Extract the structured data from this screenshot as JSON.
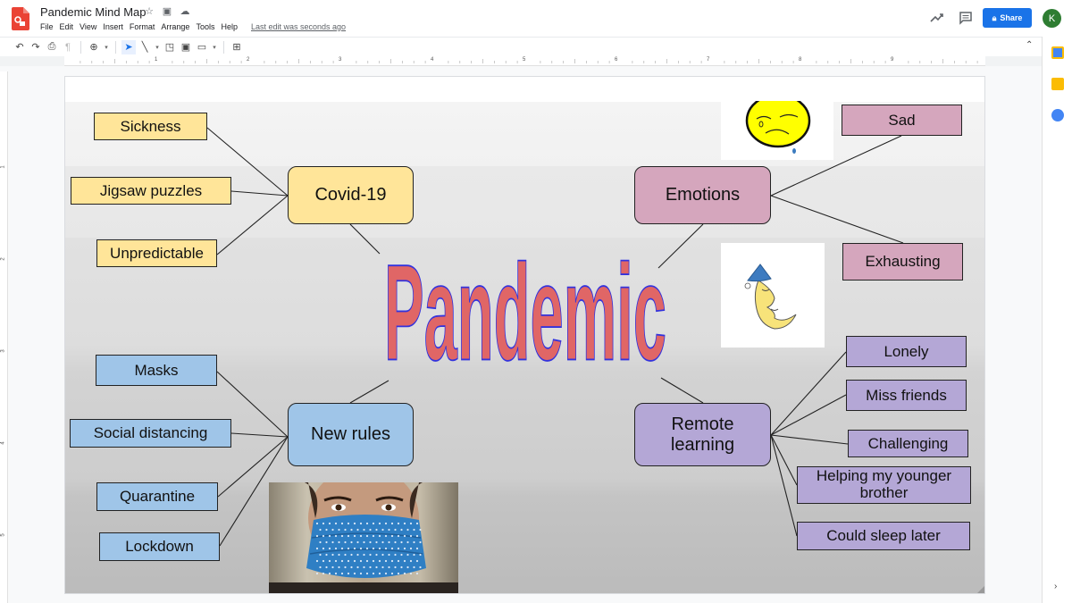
{
  "app": {
    "doc_title": "Pandemic Mind Map",
    "title_icons": [
      "star-icon",
      "move-to-folder-icon",
      "cloud-saved-icon"
    ],
    "menu": [
      "File",
      "Edit",
      "View",
      "Insert",
      "Format",
      "Arrange",
      "Tools",
      "Help"
    ],
    "last_edit": "Last edit was seconds ago",
    "share_label": "Share",
    "avatar_initial": "K",
    "accent_color": "#1a73e8"
  },
  "toolbar": {
    "buttons": [
      "undo",
      "redo",
      "print",
      "paint-format",
      "zoom",
      "select",
      "line",
      "shape",
      "text-box",
      "image",
      "comment"
    ]
  },
  "rulers": {
    "horizontal": [
      "1",
      "2",
      "3",
      "4",
      "5",
      "6",
      "7",
      "8",
      "9"
    ],
    "vertical": [
      "1",
      "2",
      "3",
      "4",
      "5"
    ]
  },
  "side_panel": {
    "icons": [
      "calendar-icon",
      "keep-icon",
      "tasks-icon"
    ]
  },
  "mindmap": {
    "center_title": "Pandemic",
    "center_colors": {
      "fill": "#e06666",
      "stroke": "#3333dd"
    },
    "branches": {
      "covid": {
        "label": "Covid-19",
        "color": "#ffe599",
        "leaves": [
          "Sickness",
          "Jigsaw puzzles",
          "Unpredictable"
        ]
      },
      "emotions": {
        "label": "Emotions",
        "color": "#d5a6bd",
        "leaves": [
          "Sad",
          "Exhausting"
        ]
      },
      "rules": {
        "label": "New rules",
        "color": "#9fc5e8",
        "leaves": [
          "Masks",
          "Social distancing",
          "Quarantine",
          "Lockdown"
        ]
      },
      "remote": {
        "label": "Remote learning",
        "color": "#b4a7d6",
        "leaves": [
          "Lonely",
          "Miss friends",
          "Challenging",
          "Helping my younger brother",
          "Could sleep later"
        ]
      }
    },
    "images": [
      "sad-face-clipart",
      "sleeping-moon-clipart",
      "masked-person-photo"
    ]
  }
}
